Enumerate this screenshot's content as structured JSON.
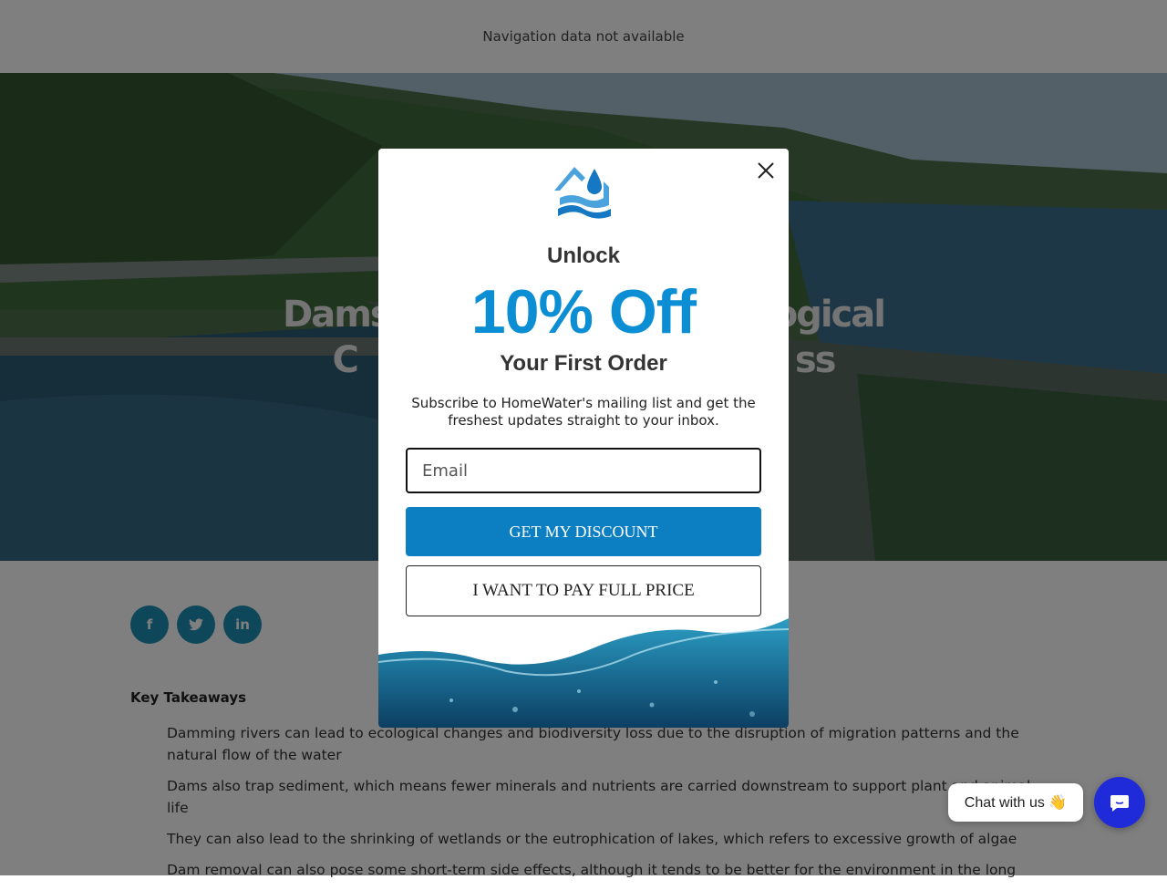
{
  "page": {
    "nav_text": "Navigation data not available",
    "hero_title_line1": "Dams",
    "hero_title_line1_right": "ogical",
    "hero_title_line2_left": "C",
    "hero_title_line2_right": "ss"
  },
  "social": {
    "facebook_icon": "f",
    "twitter_icon": "twitter-bird",
    "linkedin_icon": "in"
  },
  "key_takeaways": {
    "title": "Key Takeaways",
    "items": [
      "Damming rivers can lead to ecological changes and biodiversity loss due to the disruption of migration patterns and the natural flow of the water",
      "Dams also trap sediment, which means fewer minerals and nutrients are carried downstream to support plant and animal life",
      "They can also lead to the shrinking of wetlands or the eutrophication of lakes, which refers to excessive growth of algae",
      "Dam removal can also pose some short-term side effects, although it tends to be better for the environment in the long"
    ]
  },
  "popup": {
    "logo_icon": "homewater-logo",
    "unlock": "Unlock",
    "headline": "10% Off",
    "subheadline": "Your First Order",
    "description": "Subscribe to HomeWater's mailing list and get the freshest updates straight to your inbox.",
    "email_placeholder": "Email",
    "discount_button": "GET MY DISCOUNT",
    "decline_button": "I WANT TO PAY FULL PRICE",
    "accent_color": "#0c8ed4"
  },
  "chat": {
    "bubble_text": "Chat with us 👋",
    "button_color": "#1f2bd8"
  }
}
